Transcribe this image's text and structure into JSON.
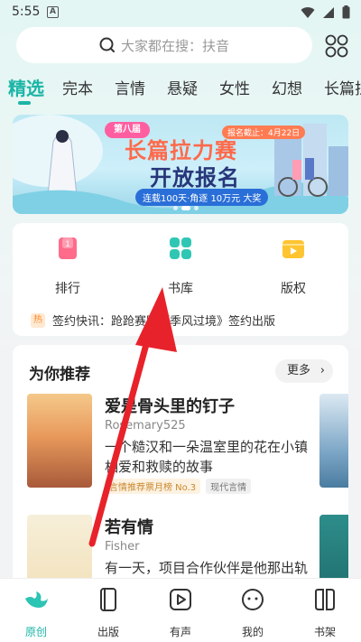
{
  "status_bar": {
    "time": "5:55",
    "notice_letter": "A"
  },
  "search": {
    "placeholder": "大家都在搜：扶音",
    "icon": "search-icon"
  },
  "tabs": [
    {
      "label": "精选",
      "active": true
    },
    {
      "label": "完本"
    },
    {
      "label": "言情"
    },
    {
      "label": "悬疑"
    },
    {
      "label": "女性"
    },
    {
      "label": "幻想"
    },
    {
      "label": "长篇拉"
    }
  ],
  "banner": {
    "badge": "第八届",
    "title_line1": "长篇拉力赛",
    "title_line2": "开放报名",
    "deadline": "报名截止：4月22日",
    "subtitle": "连载100天·角逐 10万元 大奖"
  },
  "quick_entries": [
    {
      "label": "排行",
      "icon": "ranking-icon"
    },
    {
      "label": "书库",
      "icon": "library-icon"
    },
    {
      "label": "版权",
      "icon": "copyright-icon"
    }
  ],
  "notice": {
    "tag": "热",
    "text": "签约快讯：跄跄赛跑《季风过境》签约出版"
  },
  "recommend": {
    "title": "为你推荐",
    "more_label": "更多",
    "books": [
      {
        "title": "爱是骨头里的钉子",
        "author": "Rosemary525",
        "desc": "一个糙汉和一朵温室里的花在小镇相爱和救赎的故事",
        "rank_tag": "言情推荐票月榜 No.3",
        "genre_tag": "现代言情"
      },
      {
        "title": "若有情",
        "author": "Fisher",
        "desc": "有一天，项目合作伙伴是他那出轨的前妻"
      }
    ]
  },
  "bottom_nav": [
    {
      "label": "原创",
      "icon": "bird-icon",
      "active": true
    },
    {
      "label": "出版",
      "icon": "book-icon"
    },
    {
      "label": "有声",
      "icon": "play-icon"
    },
    {
      "label": "我的",
      "icon": "profile-icon"
    },
    {
      "label": "书架",
      "icon": "bookshelf-icon"
    }
  ],
  "colors": {
    "accent": "#1bb5a6",
    "arrow": "#e8222a"
  }
}
